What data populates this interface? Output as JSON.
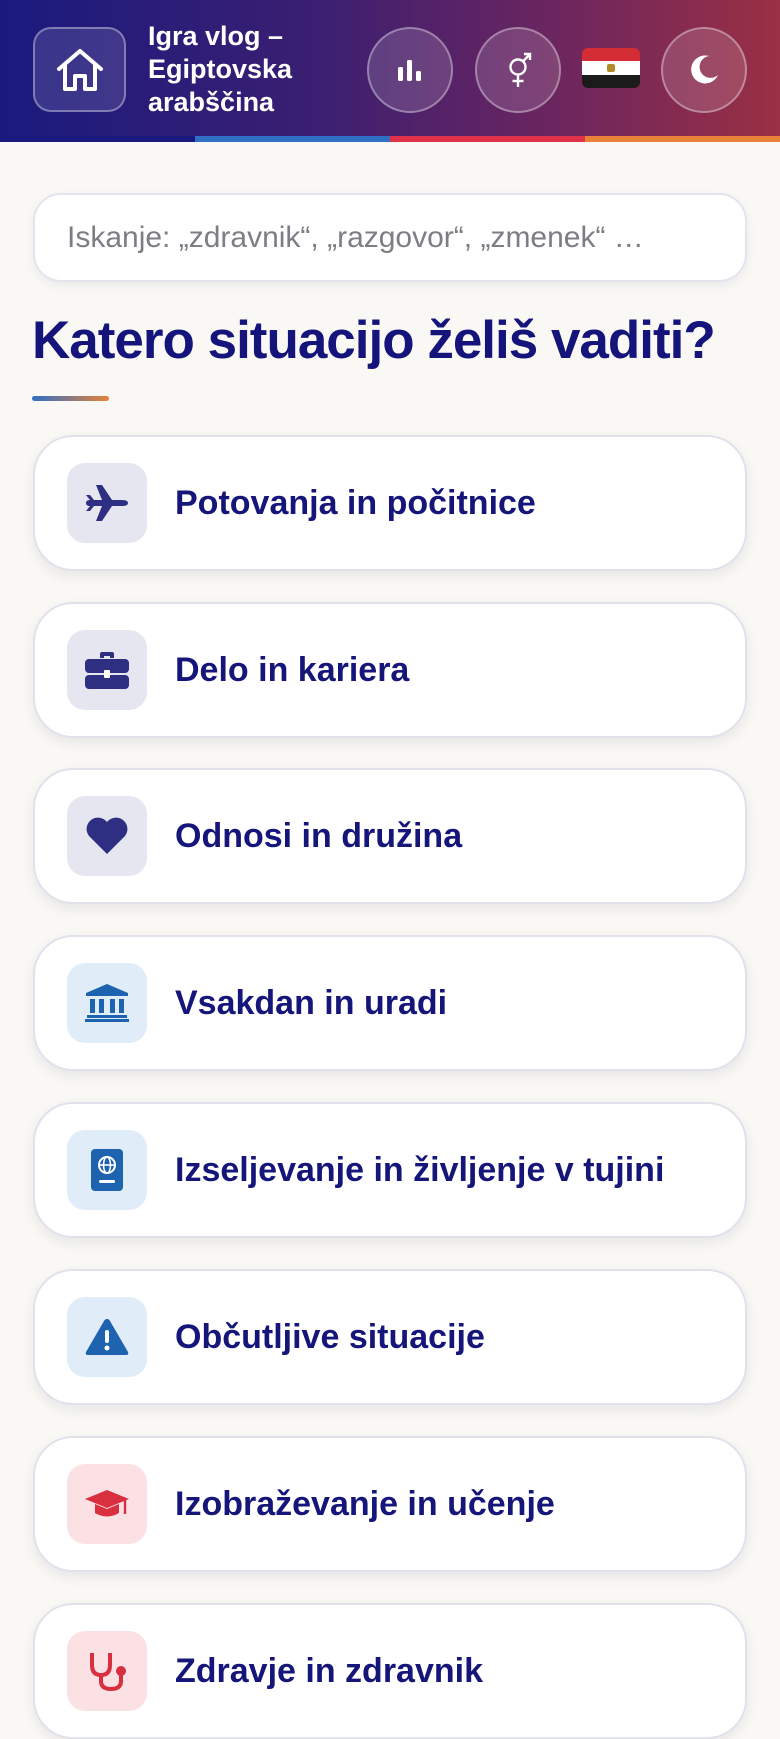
{
  "header": {
    "title": "Igra vlog – Egiptovska arabščina",
    "stripe_colors": [
      "#1a1a7e",
      "#2f6fc4",
      "#e0304a",
      "#e8823a"
    ],
    "icons": [
      "home-icon",
      "stats-icon",
      "gender-icon",
      "egypt-flag-icon",
      "moon-icon"
    ]
  },
  "search": {
    "placeholder": "Iskanje: „zdravnik“, „razgovor“, „zmenek“ …"
  },
  "main": {
    "title": "Katero situacijo želiš vaditi?",
    "categories": [
      {
        "label": "Potovanja in počitnice",
        "icon": "airplane-icon",
        "color": "#2e2e82",
        "bg": "#e6e6f1"
      },
      {
        "label": "Delo in kariera",
        "icon": "briefcase-icon",
        "color": "#2e2e82",
        "bg": "#e6e6f1"
      },
      {
        "label": "Odnosi in družina",
        "icon": "heart-icon",
        "color": "#2e2e82",
        "bg": "#e6e6f1"
      },
      {
        "label": "Vsakdan in uradi",
        "icon": "bank-icon",
        "color": "#1d63b0",
        "bg": "#e0ecf7"
      },
      {
        "label": "Izseljevanje in življenje v tujini",
        "icon": "passport-icon",
        "color": "#1d63b0",
        "bg": "#e0ecf7"
      },
      {
        "label": "Občutljive situacije",
        "icon": "warning-icon",
        "color": "#1d63b0",
        "bg": "#e0ecf7"
      },
      {
        "label": "Izobraževanje in učenje",
        "icon": "graduation-cap-icon",
        "color": "#d8303f",
        "bg": "#fbe1e4"
      },
      {
        "label": "Zdravje in zdravnik",
        "icon": "stethoscope-icon",
        "color": "#d8303f",
        "bg": "#fbe1e4"
      }
    ]
  }
}
